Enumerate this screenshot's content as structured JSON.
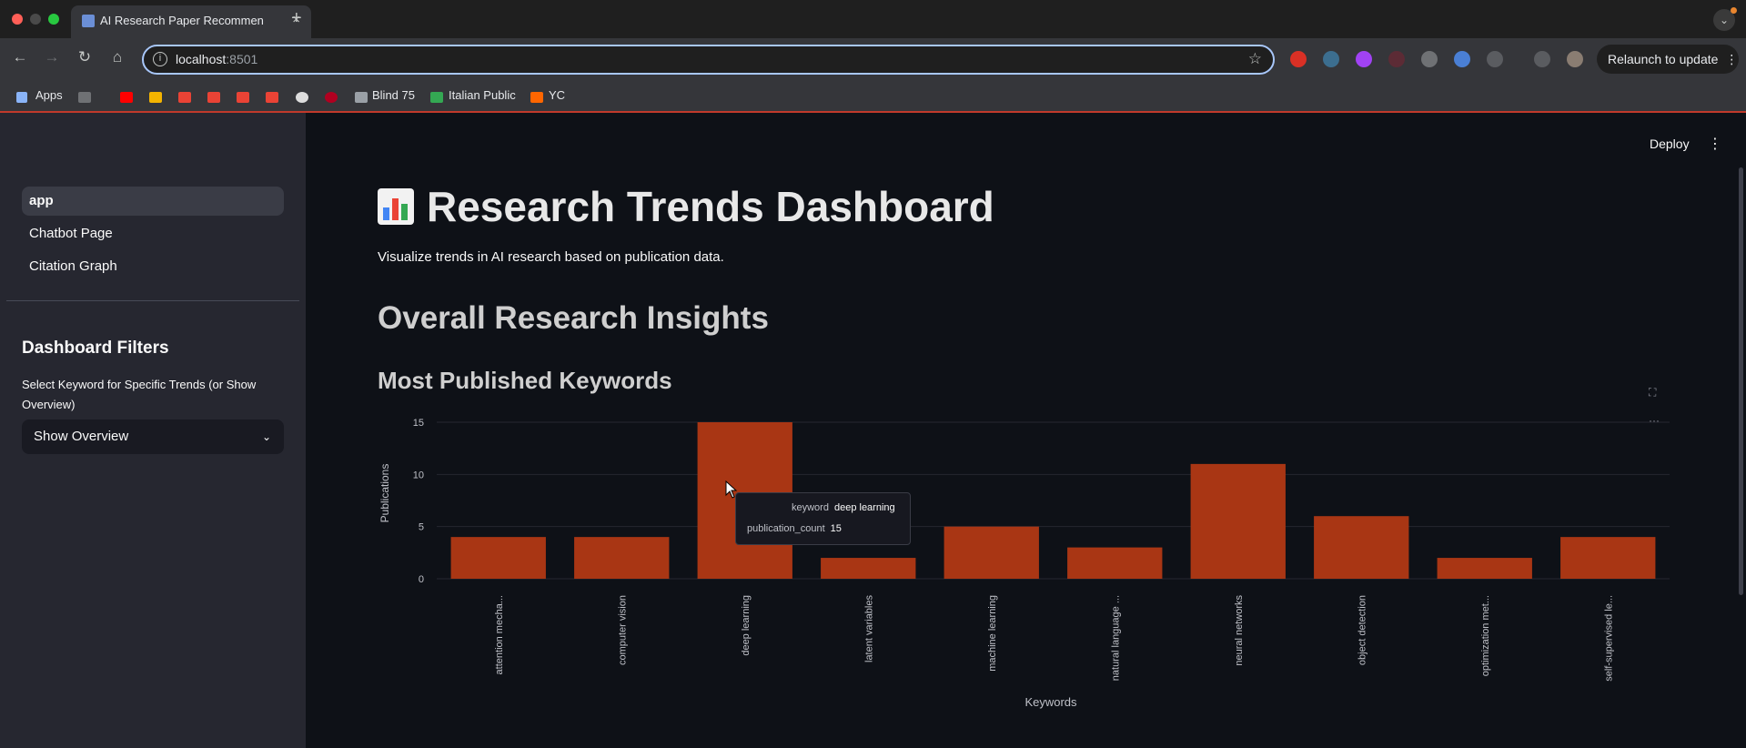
{
  "browser": {
    "tab_title": "AI Research Paper Recommen",
    "url_host": "localhost",
    "url_port": ":8501",
    "relaunch_label": "Relaunch to update",
    "bookmarks": {
      "apps": "Apps",
      "blind75": "Blind 75",
      "italian_public": "Italian Public",
      "yc": "YC"
    }
  },
  "sidebar": {
    "nav": [
      "app",
      "Chatbot Page",
      "Citation Graph"
    ],
    "filters_title": "Dashboard Filters",
    "filters_label": "Select Keyword for Specific Trends (or Show Overview)",
    "select_value": "Show Overview"
  },
  "header": {
    "deploy_label": "Deploy"
  },
  "main": {
    "title": "Research Trends Dashboard",
    "caption": "Visualize trends in AI research based on publication data.",
    "section_title": "Overall Research Insights",
    "chart_title": "Most Published Keywords"
  },
  "tooltip": {
    "keyword_label": "keyword",
    "keyword_value": "deep learning",
    "count_label": "publication_count",
    "count_value": "15"
  },
  "colors": {
    "bar": "#a93614",
    "accent": "#ff4b4b"
  },
  "chart_data": {
    "type": "bar",
    "categories": [
      "attention mecha...",
      "computer vision",
      "deep learning",
      "latent variables",
      "machine learning",
      "natural language ...",
      "neural networks",
      "object detection",
      "optimization met...",
      "self-supervised le..."
    ],
    "values": [
      4,
      4,
      15,
      2,
      5,
      3,
      11,
      6,
      2,
      4
    ],
    "xlabel": "Keywords",
    "ylabel": "Publications",
    "ylim": [
      0,
      15
    ],
    "yticks": [
      0,
      5,
      10,
      15
    ],
    "grid": true
  }
}
